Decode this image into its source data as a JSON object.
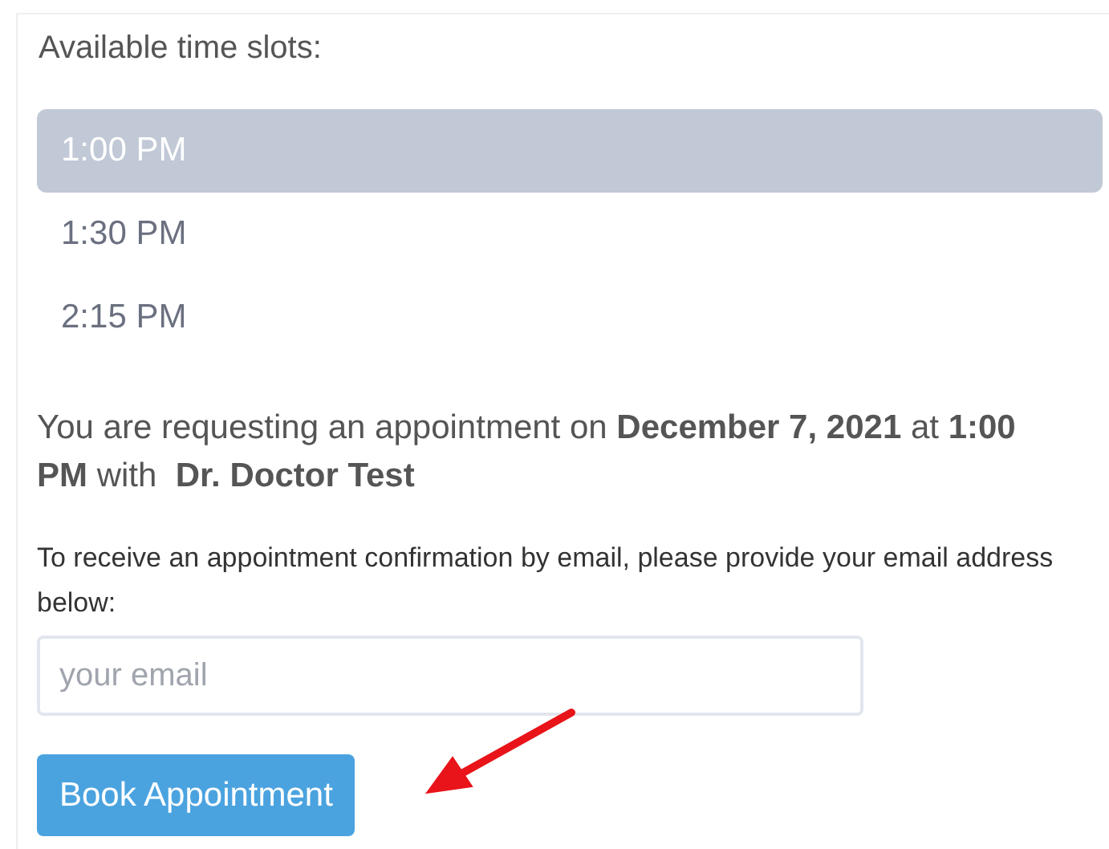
{
  "heading": "Available time slots:",
  "time_slots": [
    {
      "label": "1:00 PM",
      "selected": true
    },
    {
      "label": "1:30 PM",
      "selected": false
    },
    {
      "label": "2:15 PM",
      "selected": false
    }
  ],
  "summary": "You are requesting an appointment on **December 7, 2021** at **1:00 PM** with  **Dr. Doctor Test**",
  "email_prompt": "To receive an appointment confirmation by email, please provide your email address below:",
  "email_field": {
    "placeholder": "your email"
  },
  "book_button": "Book Appointment"
}
